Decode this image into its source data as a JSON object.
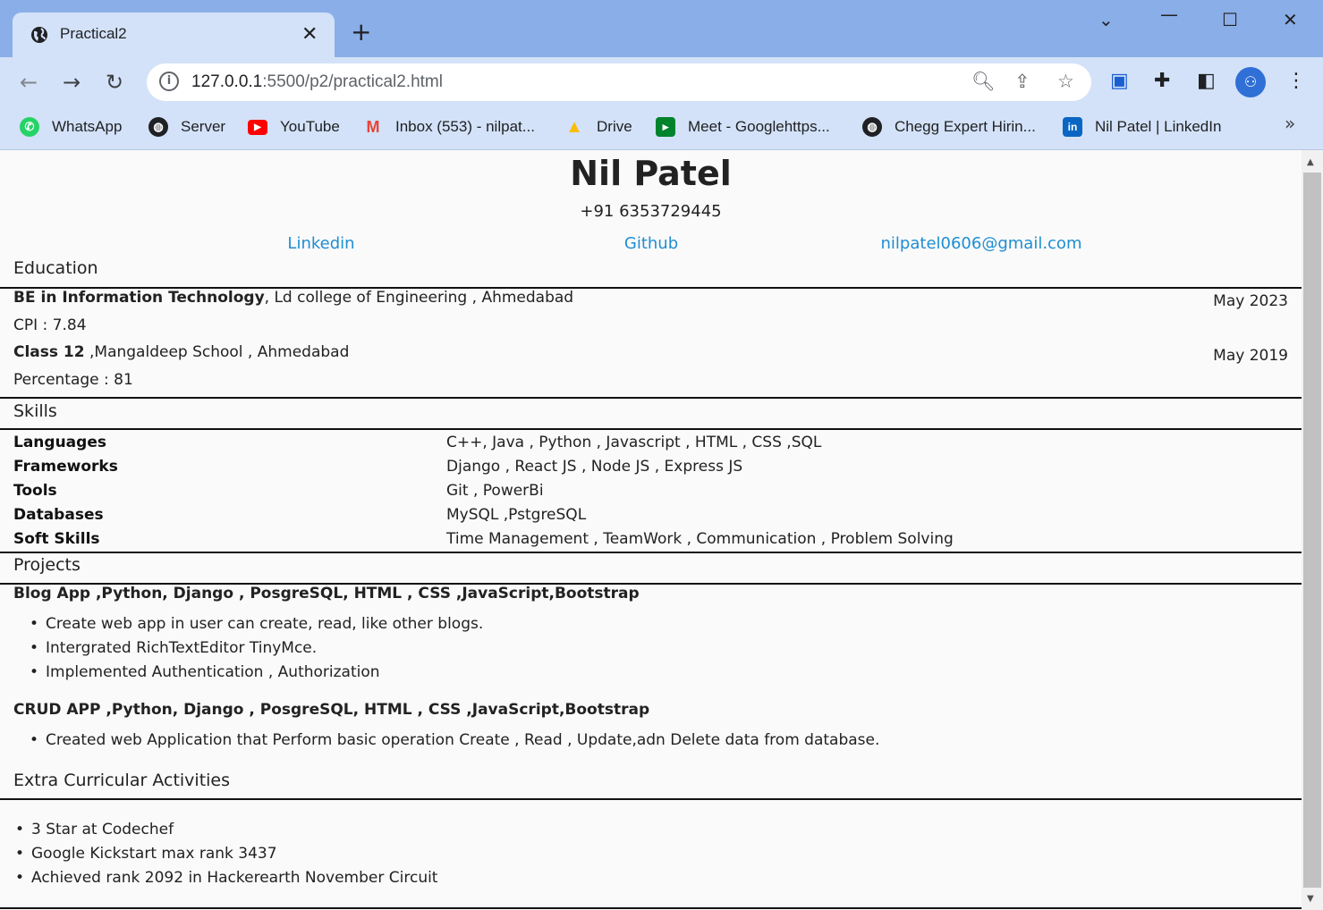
{
  "browser": {
    "tab_title": "Practical2",
    "url_host": "127.0.0.1",
    "url_path": ":5500/p2/practical2.html",
    "bookmarks": [
      {
        "label": "WhatsApp",
        "icon": "whatsapp-icon"
      },
      {
        "label": "Server",
        "icon": "globe-icon"
      },
      {
        "label": "YouTube",
        "icon": "youtube-icon"
      },
      {
        "label": "Inbox (553) - nilpat...",
        "icon": "gmail-icon"
      },
      {
        "label": "Drive",
        "icon": "drive-icon"
      },
      {
        "label": "Meet - Googlehttps...",
        "icon": "meet-icon"
      },
      {
        "label": "Chegg Expert Hirin...",
        "icon": "globe-icon"
      },
      {
        "label": "Nil Patel | LinkedIn",
        "icon": "linkedin-icon"
      }
    ]
  },
  "resume": {
    "name": "Nil Patel",
    "phone": "+91 6353729445",
    "links": {
      "linkedin": "Linkedin",
      "github": "Github",
      "email": "nilpatel0606@gmail.com"
    },
    "education": {
      "title": "Education",
      "entries": [
        {
          "degree": "BE in Information Technology",
          "place": ", Ld college of Engineering , Ahmedabad",
          "date": "May 2023",
          "score": "CPI : 7.84"
        },
        {
          "degree": "Class 12",
          "place": " ,Mangaldeep School , Ahmedabad",
          "date": "May 2019",
          "score": "Percentage : 81"
        }
      ]
    },
    "skills": {
      "title": "Skills",
      "rows": [
        {
          "key": "Languages",
          "value": "C++, Java , Python , Javascript , HTML , CSS ,SQL"
        },
        {
          "key": "Frameworks",
          "value": "Django , React JS , Node JS , Express JS"
        },
        {
          "key": "Tools",
          "value": "Git , PowerBi"
        },
        {
          "key": "Databases",
          "value": "MySQL ,PstgreSQL"
        },
        {
          "key": "Soft Skills",
          "value": "Time Management , TeamWork , Communication , Problem Solving"
        }
      ]
    },
    "projects": {
      "title": "Projects",
      "items": [
        {
          "name": "Blog App",
          "stack": " ,Python, Django , PosgreSQL, HTML , CSS ,JavaScript,Bootstrap",
          "points": [
            "Create web app in user can create, read, like other blogs.",
            "Intergrated RichTextEditor TinyMce.",
            "Implemented Authentication , Authorization"
          ]
        },
        {
          "name": "CRUD APP",
          "stack": " ,Python, Django , PosgreSQL, HTML , CSS ,JavaScript,Bootstrap",
          "points": [
            "Created web Application that Perform basic operation Create , Read , Update,adn Delete data from database."
          ]
        }
      ]
    },
    "activities": {
      "title": "Extra Curricular Activities",
      "items": [
        "3 Star at Codechef",
        "Google Kickstart max rank 3437",
        "Achieved rank 2092 in Hackerearth November Circuit"
      ]
    }
  }
}
